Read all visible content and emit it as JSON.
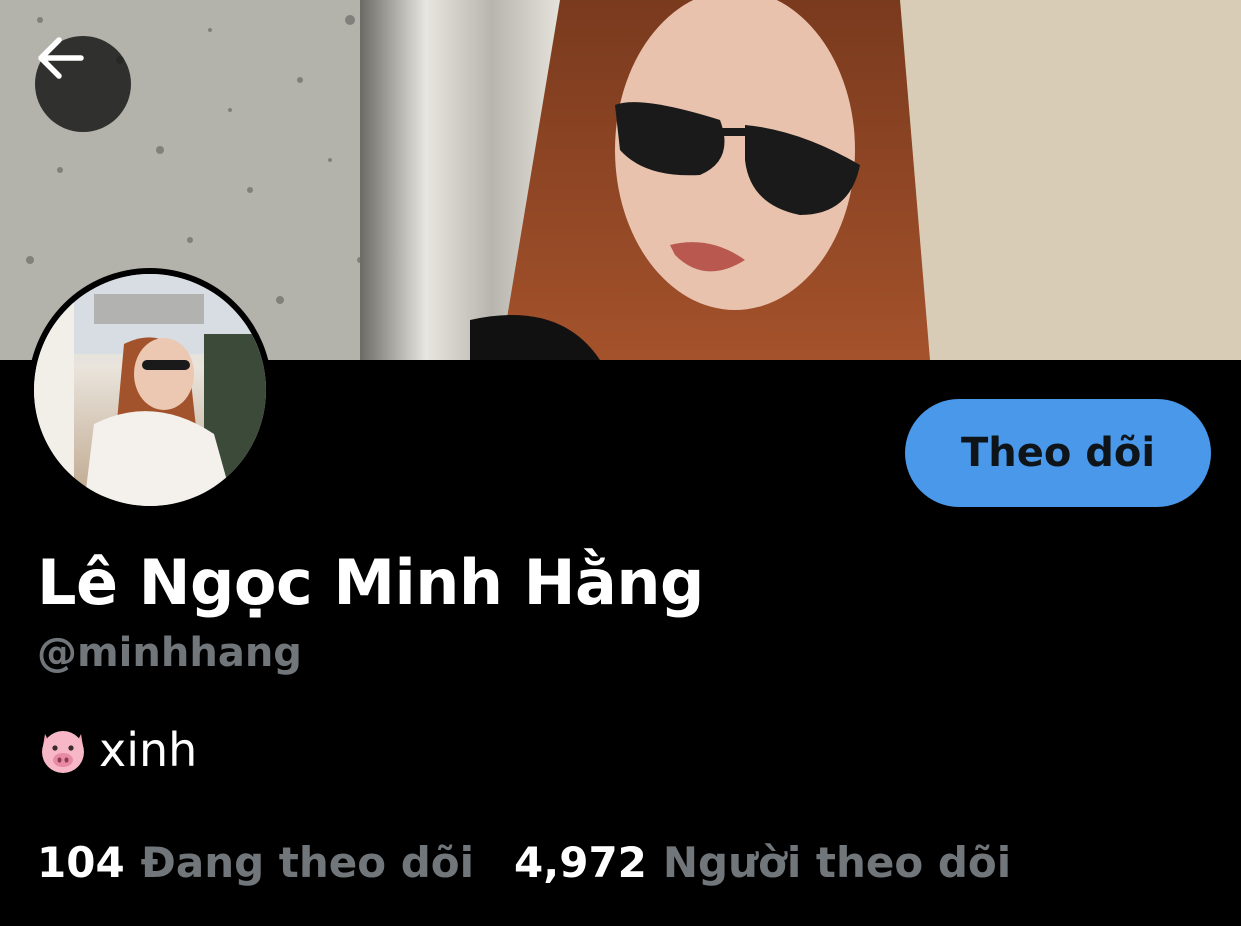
{
  "profile": {
    "display_name": "Lê Ngọc Minh Hằng",
    "handle": "@minhhang",
    "bio_text": "xinh",
    "bio_emoji": "pig-face-icon",
    "follow_label": "Theo dõi",
    "following_count": "104",
    "following_label": "Đang theo dõi",
    "followers_count": "4,972",
    "followers_label": "Người theo dõi"
  },
  "icons": {
    "back": "arrow-left-icon"
  },
  "colors": {
    "background": "#000000",
    "accent": "#4a98ea",
    "secondary_text": "#71767b",
    "primary_text": "#ffffff"
  }
}
